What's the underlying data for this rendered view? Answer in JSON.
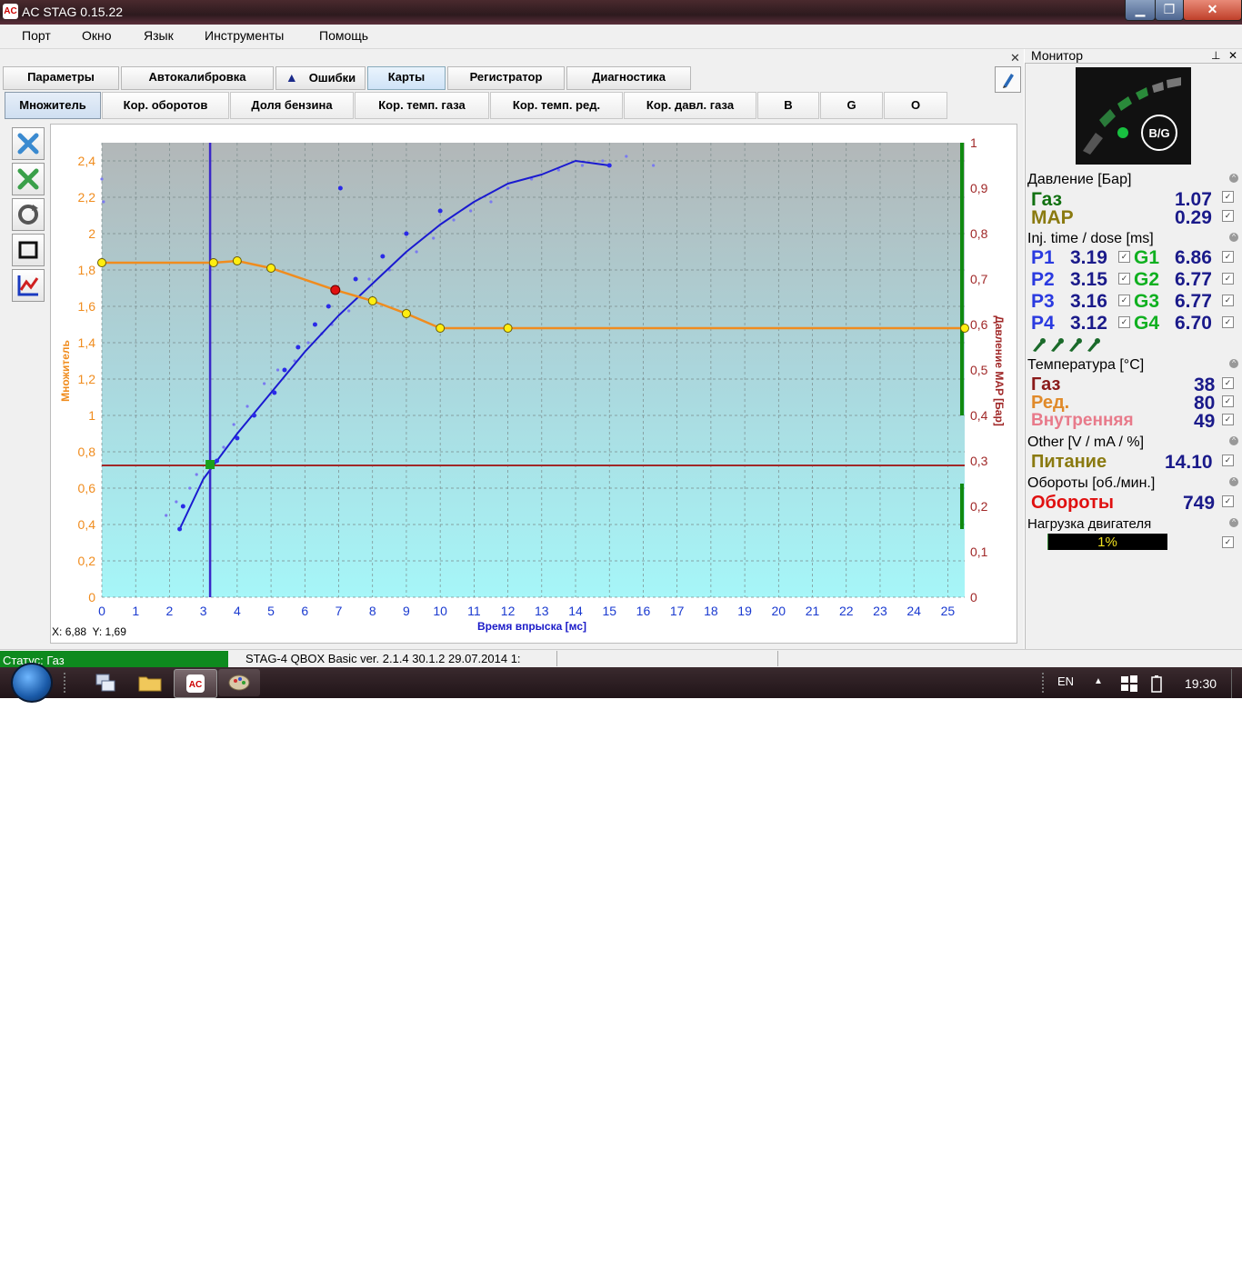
{
  "window": {
    "title": "AC STAG 0.15.22",
    "logo": "AC"
  },
  "menu": [
    "Порт",
    "Окно",
    "Язык",
    "Инструменты",
    "Помощь"
  ],
  "tabs": [
    {
      "label": "Параметры",
      "active": false
    },
    {
      "label": "Автокалибровка",
      "active": false
    },
    {
      "label": "Ошибки",
      "active": false,
      "icon": "warning-icon"
    },
    {
      "label": "Карты",
      "active": true
    },
    {
      "label": "Регистратор",
      "active": false
    },
    {
      "label": "Диагностика",
      "active": false
    }
  ],
  "subtabs": [
    {
      "label": "Множитель",
      "active": true
    },
    {
      "label": "Кор. оборотов",
      "active": false
    },
    {
      "label": "Доля бензина",
      "active": false
    },
    {
      "label": "Кор. темп. газа",
      "active": false
    },
    {
      "label": "Кор. темп. ред.",
      "active": false
    },
    {
      "label": "Кор. давл. газа",
      "active": false
    },
    {
      "label": "B",
      "active": false
    },
    {
      "label": "G",
      "active": false
    },
    {
      "label": "O",
      "active": false
    }
  ],
  "tools": [
    "clear-blue-icon",
    "clear-green-icon",
    "refresh-icon",
    "frame-icon",
    "graph-edit-icon"
  ],
  "cursor": {
    "x_label": "X:",
    "x": "6,88",
    "y_label": "Y:",
    "y": "1,69"
  },
  "chart_data": {
    "type": "line",
    "xlabel": "Время впрыска [мс]",
    "ylabel": "Множитель",
    "y2label": "Давление MAP [Бар]",
    "xlim": [
      0,
      25.5
    ],
    "ylim": [
      0,
      2.5
    ],
    "y2lim": [
      0,
      1
    ],
    "x_ticks": [
      "0",
      "1",
      "2",
      "3",
      "4",
      "5",
      "6",
      "7",
      "8",
      "9",
      "10",
      "11",
      "12",
      "13",
      "14",
      "15",
      "16",
      "17",
      "18",
      "19",
      "20",
      "21",
      "22",
      "23",
      "24",
      "25"
    ],
    "y_ticks": [
      "0",
      "0,2",
      "0,4",
      "0,6",
      "0,8",
      "1",
      "1,2",
      "1,4",
      "1,6",
      "1,8",
      "2",
      "2,2",
      "2,4"
    ],
    "y2_ticks": [
      "0",
      "0,1",
      "0,2",
      "0,3",
      "0,4",
      "0,5",
      "0,6",
      "0,7",
      "0,8",
      "0,9",
      "1"
    ],
    "colors": {
      "multiplier": "#f08c1e",
      "pressure": "#1a1ad0",
      "points": "#2a2ae8",
      "cursor_line": "#3a28c8",
      "map_line": "#a02828",
      "green_bar": "#108a10"
    },
    "multiplier_series": {
      "name": "Множитель",
      "x": [
        0,
        3.3,
        4,
        5,
        6.9,
        8,
        9,
        10,
        12,
        25.5
      ],
      "y": [
        1.84,
        1.84,
        1.85,
        1.81,
        1.69,
        1.63,
        1.56,
        1.48,
        1.48,
        1.48
      ]
    },
    "active_point": {
      "x": 6.9,
      "y": 1.69
    },
    "map_line_y2": 0.29,
    "cursor_x": 3.2,
    "cursor_point": {
      "x": 3.2,
      "y": 0.73
    },
    "pressure_curve": {
      "x": [
        2.3,
        3,
        4,
        5,
        6,
        7,
        8,
        9,
        10,
        11,
        12,
        13,
        14,
        15
      ],
      "y2": [
        0.15,
        0.26,
        0.36,
        0.45,
        0.54,
        0.62,
        0.69,
        0.76,
        0.82,
        0.87,
        0.91,
        0.93,
        0.96,
        0.95
      ]
    },
    "samples_dark": {
      "x": [
        2.3,
        2.4,
        3.4,
        4,
        4.5,
        5.1,
        5.4,
        5.8,
        6.3,
        6.7,
        7.05,
        7.5,
        8.3,
        9,
        10,
        15
      ],
      "y2": [
        0.15,
        0.2,
        0.3,
        0.35,
        0.4,
        0.45,
        0.5,
        0.55,
        0.6,
        0.64,
        0.9,
        0.7,
        0.75,
        0.8,
        0.85,
        0.95
      ]
    },
    "samples_light": {
      "x": [
        0,
        0.05,
        1.9,
        2.2,
        2.6,
        2.8,
        3.1,
        3.6,
        3.9,
        4.3,
        4.8,
        5.2,
        5.7,
        6.1,
        6.5,
        6.8,
        7.3,
        7.9,
        8.5,
        9.3,
        9.8,
        10.4,
        10.9,
        11.5,
        12,
        12.7,
        13.5,
        14.2,
        14.8,
        15.5,
        16.3
      ],
      "y2": [
        0.92,
        0.87,
        0.18,
        0.21,
        0.24,
        0.27,
        0.29,
        0.33,
        0.38,
        0.42,
        0.47,
        0.5,
        0.52,
        0.56,
        0.58,
        0.6,
        0.63,
        0.7,
        0.72,
        0.76,
        0.79,
        0.83,
        0.85,
        0.87,
        0.9,
        0.92,
        0.94,
        0.95,
        0.96,
        0.97,
        0.95
      ]
    }
  },
  "monitor": {
    "title": "Монитор",
    "logo_text": "B/G",
    "pressure": {
      "header": "Давление [Бар]",
      "rows": [
        {
          "label": "Газ",
          "value": "1.07",
          "color": "#107010"
        },
        {
          "label": "MAP",
          "value": "0.29",
          "color": "#8a7a10"
        }
      ]
    },
    "inj": {
      "header": "Inj. time / dose [ms]",
      "rows": [
        {
          "p": "P1",
          "pv": "3.19",
          "g": "G1",
          "gv": "6.86"
        },
        {
          "p": "P2",
          "pv": "3.15",
          "g": "G2",
          "gv": "6.77"
        },
        {
          "p": "P3",
          "pv": "3.16",
          "g": "G3",
          "gv": "6.77"
        },
        {
          "p": "P4",
          "pv": "3.12",
          "g": "G4",
          "gv": "6.70"
        }
      ]
    },
    "temperature": {
      "header": "Температура [°C]",
      "rows": [
        {
          "label": "Газ",
          "value": "38",
          "color": "#8a1a1a"
        },
        {
          "label": "Ред.",
          "value": "80",
          "color": "#e08a2a"
        },
        {
          "label": "Внутренняя",
          "value": "49",
          "color": "#e87a8a"
        }
      ]
    },
    "other": {
      "header": "Other [V / mA / %]",
      "rows": [
        {
          "label": "Питание",
          "value": "14.10",
          "color": "#8a7a10"
        }
      ]
    },
    "rpm": {
      "header": "Обороты [об./мин.]",
      "rows": [
        {
          "label": "Обороты",
          "value": "749",
          "color": "#e01010"
        }
      ]
    },
    "load": {
      "header": "Нагрузка двигателя",
      "value": "1%",
      "fraction": 0.01
    }
  },
  "status": {
    "mode": "Статус: Газ",
    "version": "STAG-4 QBOX Basic  ver. 2.1.4  30.1.2   29.07.2014 1:"
  },
  "taskbar": {
    "lang": "EN",
    "time": "19:30"
  }
}
